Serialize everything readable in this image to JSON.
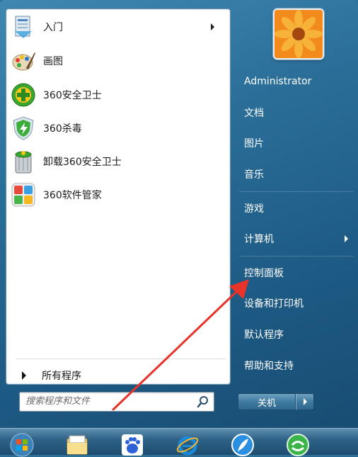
{
  "left_programs": [
    {
      "label": "入门",
      "icon": "getting-started-icon",
      "has_submenu": true
    },
    {
      "label": "画图",
      "icon": "paint-palette-icon",
      "has_submenu": false
    },
    {
      "label": "360安全卫士",
      "icon": "360-safeguard-icon",
      "has_submenu": false
    },
    {
      "label": "360杀毒",
      "icon": "360-antivirus-shield-icon",
      "has_submenu": false
    },
    {
      "label": "卸载360安全卫士",
      "icon": "uninstall-trashcan-icon",
      "has_submenu": false
    },
    {
      "label": "360软件管家",
      "icon": "360-software-manager-icon",
      "has_submenu": false
    }
  ],
  "all_programs": {
    "label": "所有程序"
  },
  "search": {
    "placeholder": "搜索程序和文件"
  },
  "user": {
    "name": "Administrator"
  },
  "right_items": [
    {
      "label": "文档",
      "has_submenu": false
    },
    {
      "label": "图片",
      "has_submenu": false
    },
    {
      "label": "音乐",
      "has_submenu": false
    },
    {
      "label": "游戏",
      "has_submenu": false
    },
    {
      "label": "计算机",
      "has_submenu": true
    },
    {
      "label": "控制面板",
      "has_submenu": false
    },
    {
      "label": "设备和打印机",
      "has_submenu": false
    },
    {
      "label": "默认程序",
      "has_submenu": false
    },
    {
      "label": "帮助和支持",
      "has_submenu": false
    }
  ],
  "shutdown": {
    "label": "关机"
  },
  "taskbar_icons": [
    "windows-start-orb-icon",
    "file-explorer-icon",
    "baidu-paw-icon",
    "internet-explorer-icon",
    "feather-app-icon",
    "green-circle-app-icon"
  ],
  "colors": {
    "annotation_arrow": "#e8332b",
    "menu_blue": "#2a6e98"
  }
}
